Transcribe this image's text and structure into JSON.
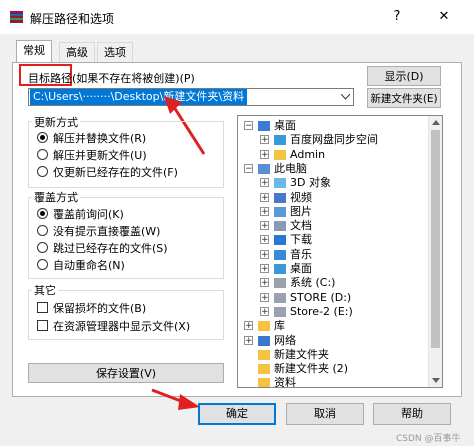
{
  "window": {
    "title": "解压路径和选项",
    "help_label": "?",
    "close_label": "✕"
  },
  "tabs": [
    {
      "label": "常规"
    },
    {
      "label": "高级"
    },
    {
      "label": "选项"
    }
  ],
  "target": {
    "label_prefix": "目标路径",
    "label_rest": "(如果不存在将被创建)(P)",
    "path_value": "C:\\Users\\········\\Desktop\\新建文件夹\\资料",
    "show_button": "显示(D)",
    "new_folder_button": "新建文件夹(E)"
  },
  "update_group": {
    "title": "更新方式",
    "options": [
      {
        "label": "解压并替换文件(R)",
        "selected": true
      },
      {
        "label": "解压并更新文件(U)",
        "selected": false
      },
      {
        "label": "仅更新已经存在的文件(F)",
        "selected": false
      }
    ]
  },
  "overwrite_group": {
    "title": "覆盖方式",
    "options": [
      {
        "label": "覆盖前询问(K)",
        "selected": true
      },
      {
        "label": "没有提示直接覆盖(W)",
        "selected": false
      },
      {
        "label": "跳过已经存在的文件(S)",
        "selected": false
      },
      {
        "label": "自动重命名(N)",
        "selected": false
      }
    ]
  },
  "other_group": {
    "title": "其它",
    "options": [
      {
        "label": "保留损坏的文件(B)",
        "checked": false
      },
      {
        "label": "在资源管理器中显示文件(X)",
        "checked": false
      }
    ]
  },
  "save_settings_button": "保存设置(V)",
  "tree": {
    "items": [
      {
        "label": "桌面",
        "icon": "desktop-icon",
        "expander": "−"
      },
      {
        "label": "百度网盘同步空间",
        "icon": "baidu-netdisk-icon",
        "expander": "+"
      },
      {
        "label": "Admin",
        "icon": "user-folder-icon",
        "expander": "+"
      },
      {
        "label": "此电脑",
        "icon": "computer-icon",
        "expander": "−"
      },
      {
        "label": "3D 对象",
        "icon": "3d-objects-icon",
        "expander": "+"
      },
      {
        "label": "视频",
        "icon": "video-folder-icon",
        "expander": "+"
      },
      {
        "label": "图片",
        "icon": "pictures-folder-icon",
        "expander": "+"
      },
      {
        "label": "文档",
        "icon": "documents-folder-icon",
        "expander": "+"
      },
      {
        "label": "下载",
        "icon": "download-folder-icon",
        "expander": "+"
      },
      {
        "label": "音乐",
        "icon": "music-folder-icon",
        "expander": "+"
      },
      {
        "label": "桌面",
        "icon": "desktop-folder-icon",
        "expander": "+"
      },
      {
        "label": "系统 (C:)",
        "icon": "drive-icon",
        "expander": "+"
      },
      {
        "label": "STORE (D:)",
        "icon": "drive-icon",
        "expander": "+"
      },
      {
        "label": "Store-2 (E:)",
        "icon": "drive-icon",
        "expander": "+"
      },
      {
        "label": "库",
        "icon": "library-icon",
        "expander": "+"
      },
      {
        "label": "网络",
        "icon": "network-icon",
        "expander": "+"
      },
      {
        "label": "新建文件夹",
        "icon": "folder-icon",
        "expander": ""
      },
      {
        "label": "新建文件夹 (2)",
        "icon": "folder-icon",
        "expander": ""
      },
      {
        "label": "资料",
        "icon": "folder-icon",
        "expander": ""
      }
    ]
  },
  "footer": {
    "ok": "确定",
    "cancel": "取消",
    "help": "帮助"
  },
  "watermark": "CSDN @百事牛",
  "colors": {
    "accent": "#0078d7",
    "annotation_red": "#e02020",
    "folder_yellow": "#f5c342"
  }
}
